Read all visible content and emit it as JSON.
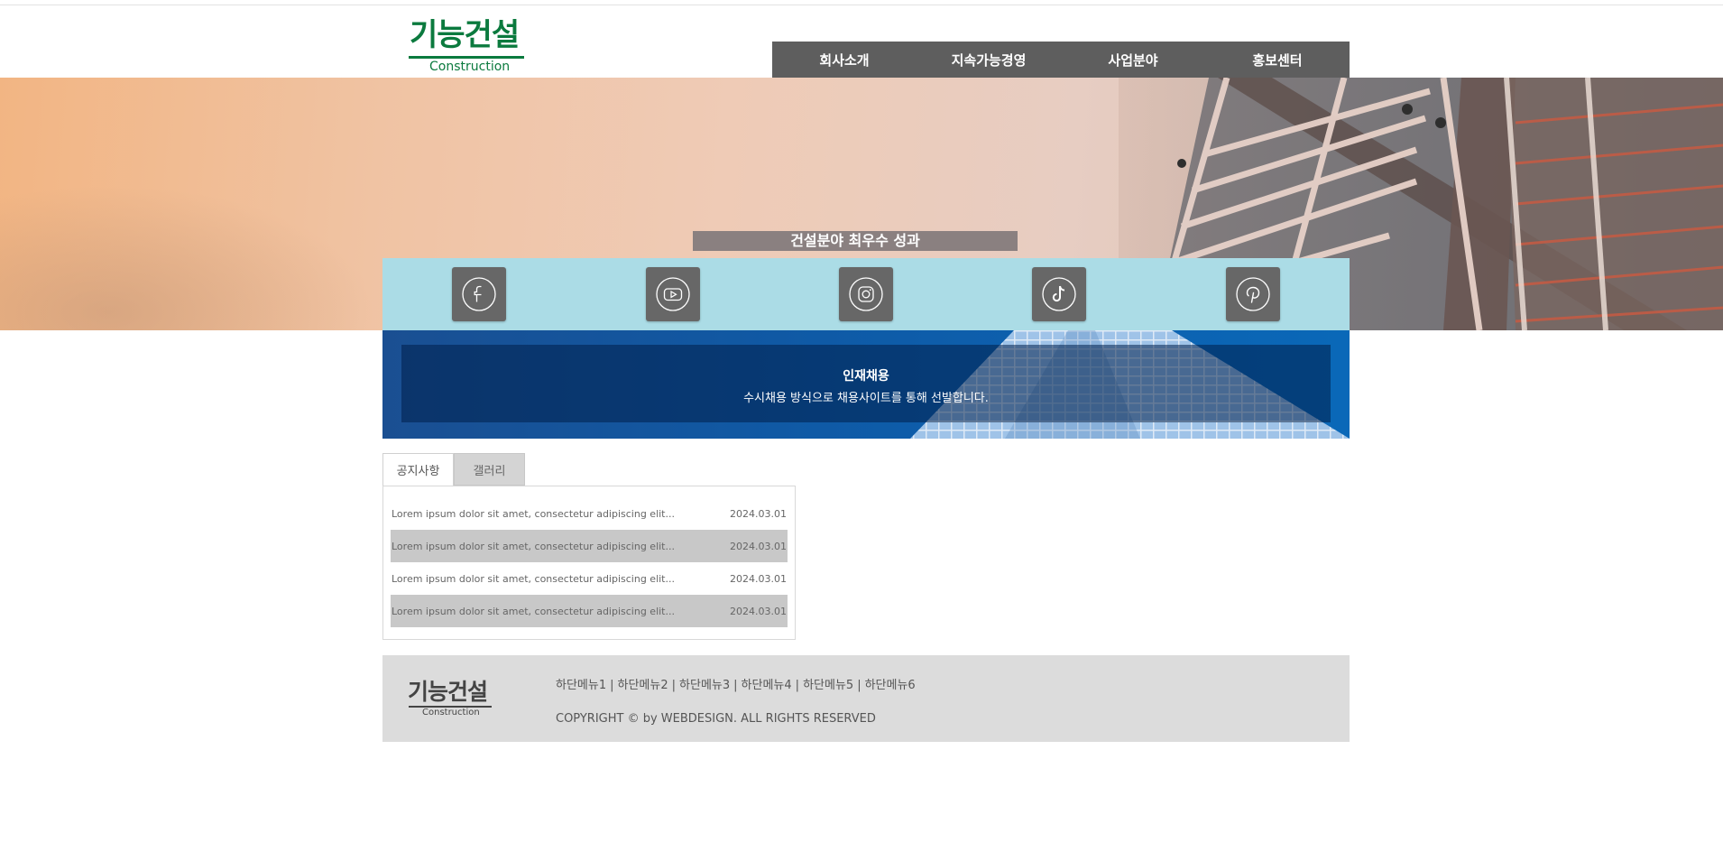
{
  "header": {
    "logo_ko": "기능건설",
    "logo_en": "Construction",
    "nav": [
      "회사소개",
      "지속가능경영",
      "사업분야",
      "홍보센터"
    ]
  },
  "hero": {
    "title": "건설분야 최우수 성과"
  },
  "sns": [
    {
      "icon": "facebook-icon"
    },
    {
      "icon": "youtube-icon"
    },
    {
      "icon": "instagram-icon"
    },
    {
      "icon": "tiktok-icon"
    },
    {
      "icon": "pinterest-icon"
    }
  ],
  "recruit": {
    "title": "인재채용",
    "subtitle": "수시채용 방식으로 채용사이트를 통해 선발합니다."
  },
  "board": {
    "tabs": [
      "공지사항",
      "갤러리"
    ],
    "rows": [
      {
        "title": "Lorem ipsum dolor sit amet, consectetur adipiscing elit...",
        "date": "2024.03.01"
      },
      {
        "title": "Lorem ipsum dolor sit amet, consectetur adipiscing elit...",
        "date": "2024.03.01"
      },
      {
        "title": "Lorem ipsum dolor sit amet, consectetur adipiscing elit...",
        "date": "2024.03.01"
      },
      {
        "title": "Lorem ipsum dolor sit amet, consectetur adipiscing elit...",
        "date": "2024.03.01"
      }
    ]
  },
  "footer": {
    "logo_ko": "기능건설",
    "logo_en": "Construction",
    "menu": [
      "하단메뉴1",
      "하단메뉴2",
      "하단메뉴3",
      "하단메뉴4",
      "하단메뉴5",
      "하단메뉴6"
    ],
    "separator": "|",
    "copyright": "COPYRIGHT © by WEBDESIGN. ALL RIGHTS RESERVED"
  },
  "colors": {
    "brand_green": "#0b7a3e",
    "nav_bg": "#5e5e5e",
    "sns_bar": "#abdce6",
    "recruit_blue": "#0a68b8",
    "footer_bg": "#dcdcdc"
  }
}
